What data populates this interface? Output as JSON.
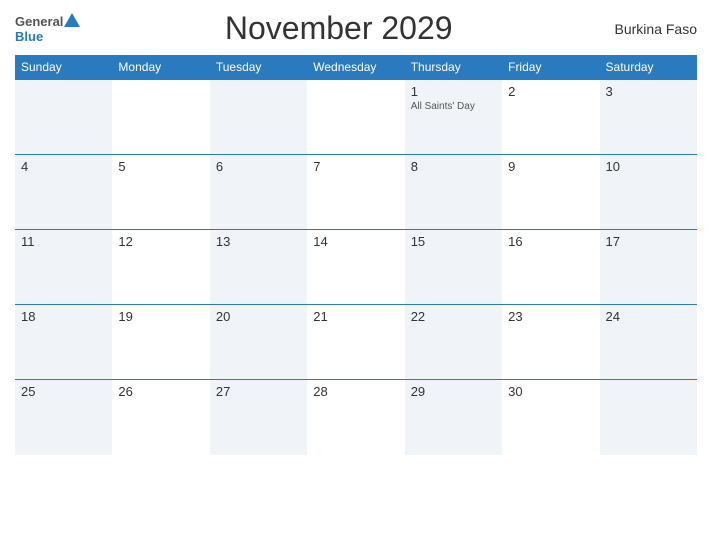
{
  "header": {
    "title": "November 2029",
    "country": "Burkina Faso",
    "logo": {
      "general": "General",
      "blue": "Blue"
    }
  },
  "weekdays": [
    "Sunday",
    "Monday",
    "Tuesday",
    "Wednesday",
    "Thursday",
    "Friday",
    "Saturday"
  ],
  "weeks": [
    [
      {
        "day": "",
        "holiday": ""
      },
      {
        "day": "",
        "holiday": ""
      },
      {
        "day": "",
        "holiday": ""
      },
      {
        "day": "",
        "holiday": ""
      },
      {
        "day": "1",
        "holiday": "All Saints' Day"
      },
      {
        "day": "2",
        "holiday": ""
      },
      {
        "day": "3",
        "holiday": ""
      }
    ],
    [
      {
        "day": "4",
        "holiday": ""
      },
      {
        "day": "5",
        "holiday": ""
      },
      {
        "day": "6",
        "holiday": ""
      },
      {
        "day": "7",
        "holiday": ""
      },
      {
        "day": "8",
        "holiday": ""
      },
      {
        "day": "9",
        "holiday": ""
      },
      {
        "day": "10",
        "holiday": ""
      }
    ],
    [
      {
        "day": "11",
        "holiday": ""
      },
      {
        "day": "12",
        "holiday": ""
      },
      {
        "day": "13",
        "holiday": ""
      },
      {
        "day": "14",
        "holiday": ""
      },
      {
        "day": "15",
        "holiday": ""
      },
      {
        "day": "16",
        "holiday": ""
      },
      {
        "day": "17",
        "holiday": ""
      }
    ],
    [
      {
        "day": "18",
        "holiday": ""
      },
      {
        "day": "19",
        "holiday": ""
      },
      {
        "day": "20",
        "holiday": ""
      },
      {
        "day": "21",
        "holiday": ""
      },
      {
        "day": "22",
        "holiday": ""
      },
      {
        "day": "23",
        "holiday": ""
      },
      {
        "day": "24",
        "holiday": ""
      }
    ],
    [
      {
        "day": "25",
        "holiday": ""
      },
      {
        "day": "26",
        "holiday": ""
      },
      {
        "day": "27",
        "holiday": ""
      },
      {
        "day": "28",
        "holiday": ""
      },
      {
        "day": "29",
        "holiday": ""
      },
      {
        "day": "30",
        "holiday": ""
      },
      {
        "day": "",
        "holiday": ""
      }
    ]
  ]
}
